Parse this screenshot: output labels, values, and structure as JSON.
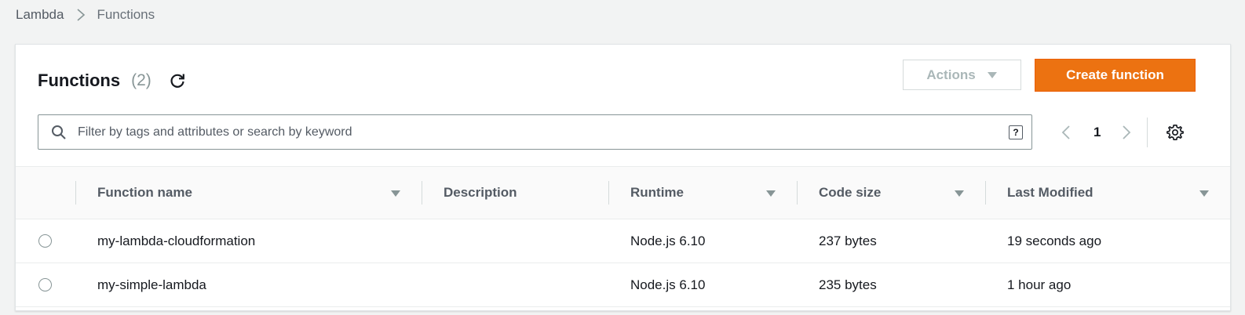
{
  "breadcrumb": {
    "root": "Lambda",
    "current": "Functions"
  },
  "panel": {
    "title": "Functions",
    "count": "(2)",
    "actions_label": "Actions",
    "create_label": "Create function"
  },
  "search": {
    "placeholder": "Filter by tags and attributes or search by keyword",
    "value": "",
    "help_label": "?"
  },
  "pagination": {
    "page": "1"
  },
  "table": {
    "columns": [
      "Function name",
      "Description",
      "Runtime",
      "Code size",
      "Last Modified"
    ],
    "rows": [
      {
        "name": "my-lambda-cloudformation",
        "description": "",
        "runtime": "Node.js 6.10",
        "code_size": "237 bytes",
        "last_modified": "19 seconds ago"
      },
      {
        "name": "my-simple-lambda",
        "description": "",
        "runtime": "Node.js 6.10",
        "code_size": "235 bytes",
        "last_modified": "1 hour ago"
      }
    ]
  },
  "colors": {
    "accent": "#ec7211",
    "text": "#16191f",
    "muted": "#545b64",
    "border": "#d5dbdb"
  },
  "icons": [
    "chevron-right-icon",
    "refresh-icon",
    "caret-down-icon",
    "search-icon",
    "help-icon",
    "chevron-left-icon",
    "gear-icon",
    "sort-icon",
    "radio-icon"
  ]
}
